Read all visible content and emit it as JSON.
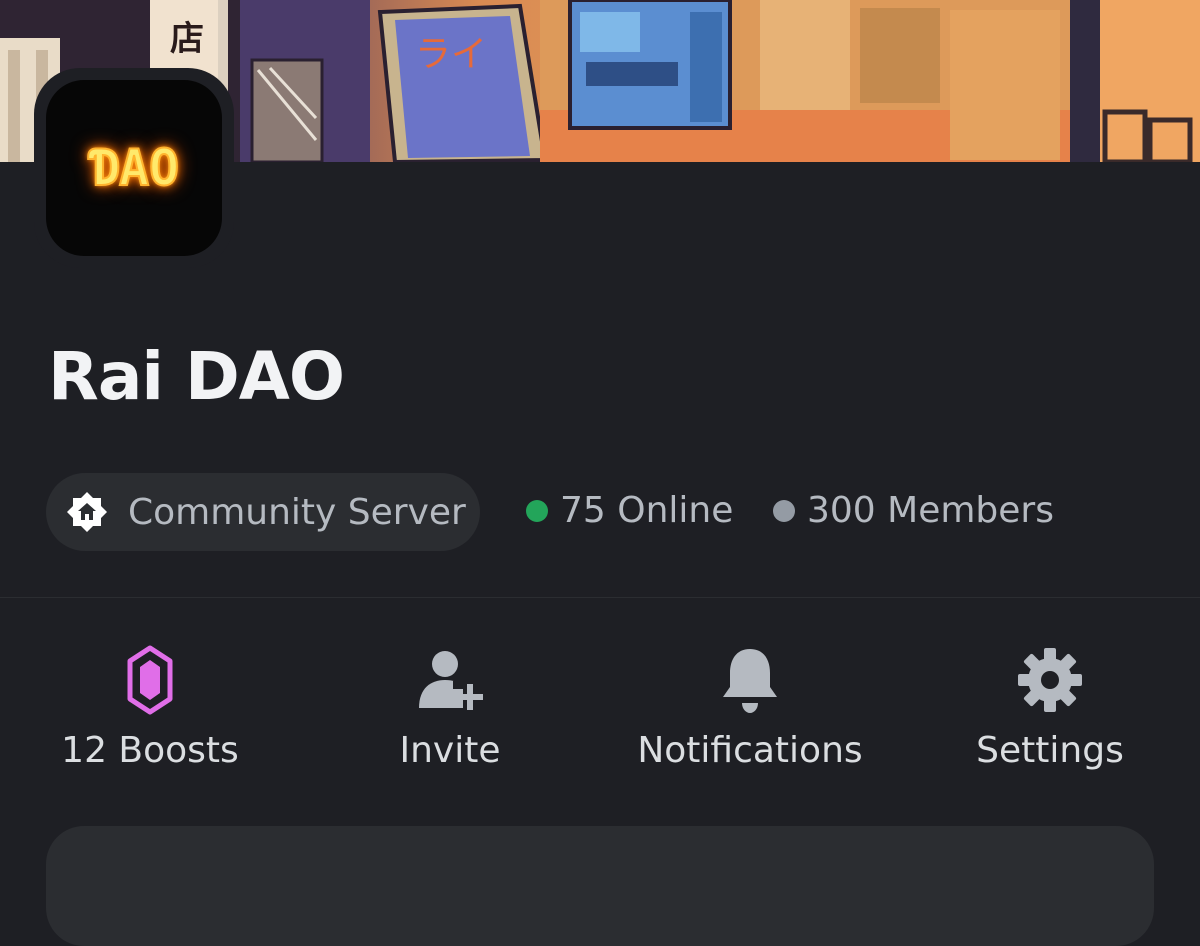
{
  "server": {
    "name": "Rai DAO",
    "logo_text": "ƊAO",
    "type_label": "Community Server",
    "type_icon": "community-home-icon"
  },
  "stats": {
    "online": "75 Online",
    "members": "300 Members",
    "online_color": "#23a55a",
    "members_color": "#949ba4"
  },
  "actions": [
    {
      "label": "12 Boosts",
      "icon": "boost-gem-icon",
      "color": "#e06ee8"
    },
    {
      "label": "Invite",
      "icon": "add-user-icon",
      "color": "#b5bac1"
    },
    {
      "label": "Notifications",
      "icon": "bell-icon",
      "color": "#b5bac1"
    },
    {
      "label": "Settings",
      "icon": "gear-icon",
      "color": "#b5bac1"
    }
  ],
  "colors": {
    "background": "#1e1f24",
    "surface": "#2b2d31",
    "text": "#dbdee1",
    "muted": "#b5bac1"
  }
}
